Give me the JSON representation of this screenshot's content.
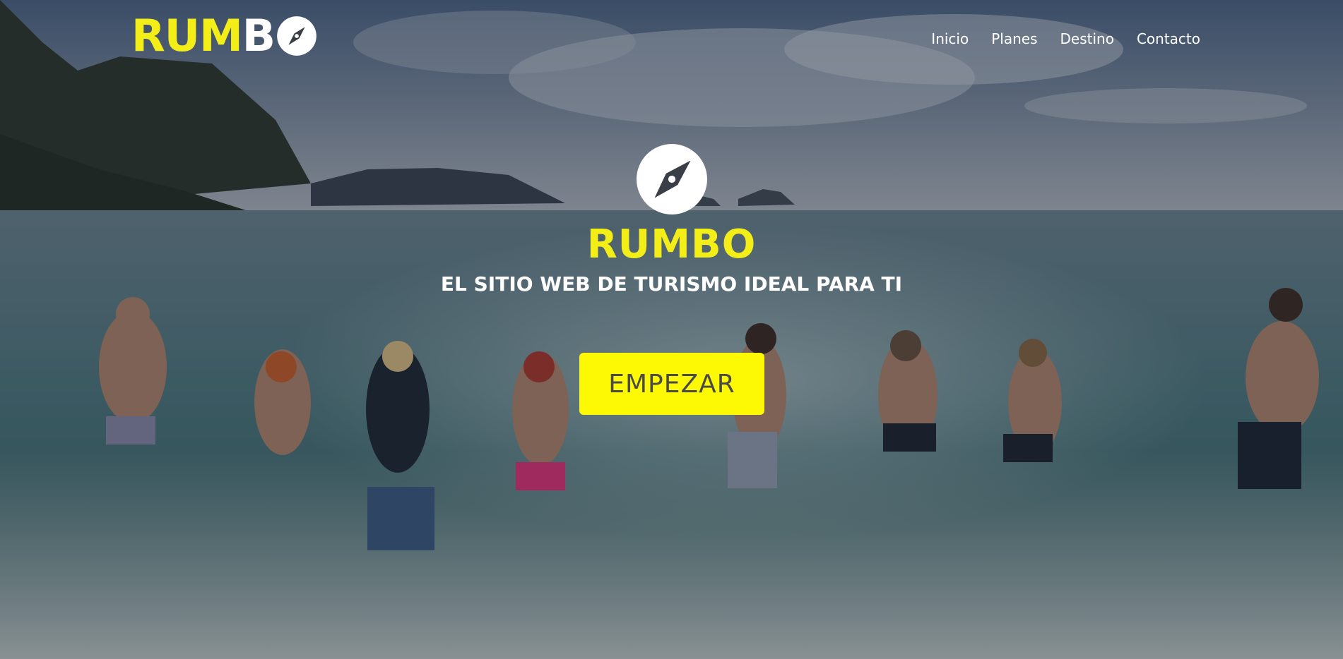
{
  "app": {
    "logo_part1": "RUM",
    "logo_part2": "B",
    "logo_icon": "compass-icon"
  },
  "nav": {
    "items": [
      {
        "label": "Inicio"
      },
      {
        "label": "Planes"
      },
      {
        "label": "Destino"
      },
      {
        "label": "Contacto"
      }
    ]
  },
  "hero": {
    "icon": "compass-icon",
    "title": "RUMBO",
    "tagline": "EL SITIO WEB DE TURISMO IDEAL PARA TI",
    "cta_label": "EMPEZAR"
  },
  "colors": {
    "accent_yellow": "#f4ee18",
    "button_yellow": "#fdf803",
    "text_white": "#ffffff",
    "button_text": "#4a4a4a"
  }
}
